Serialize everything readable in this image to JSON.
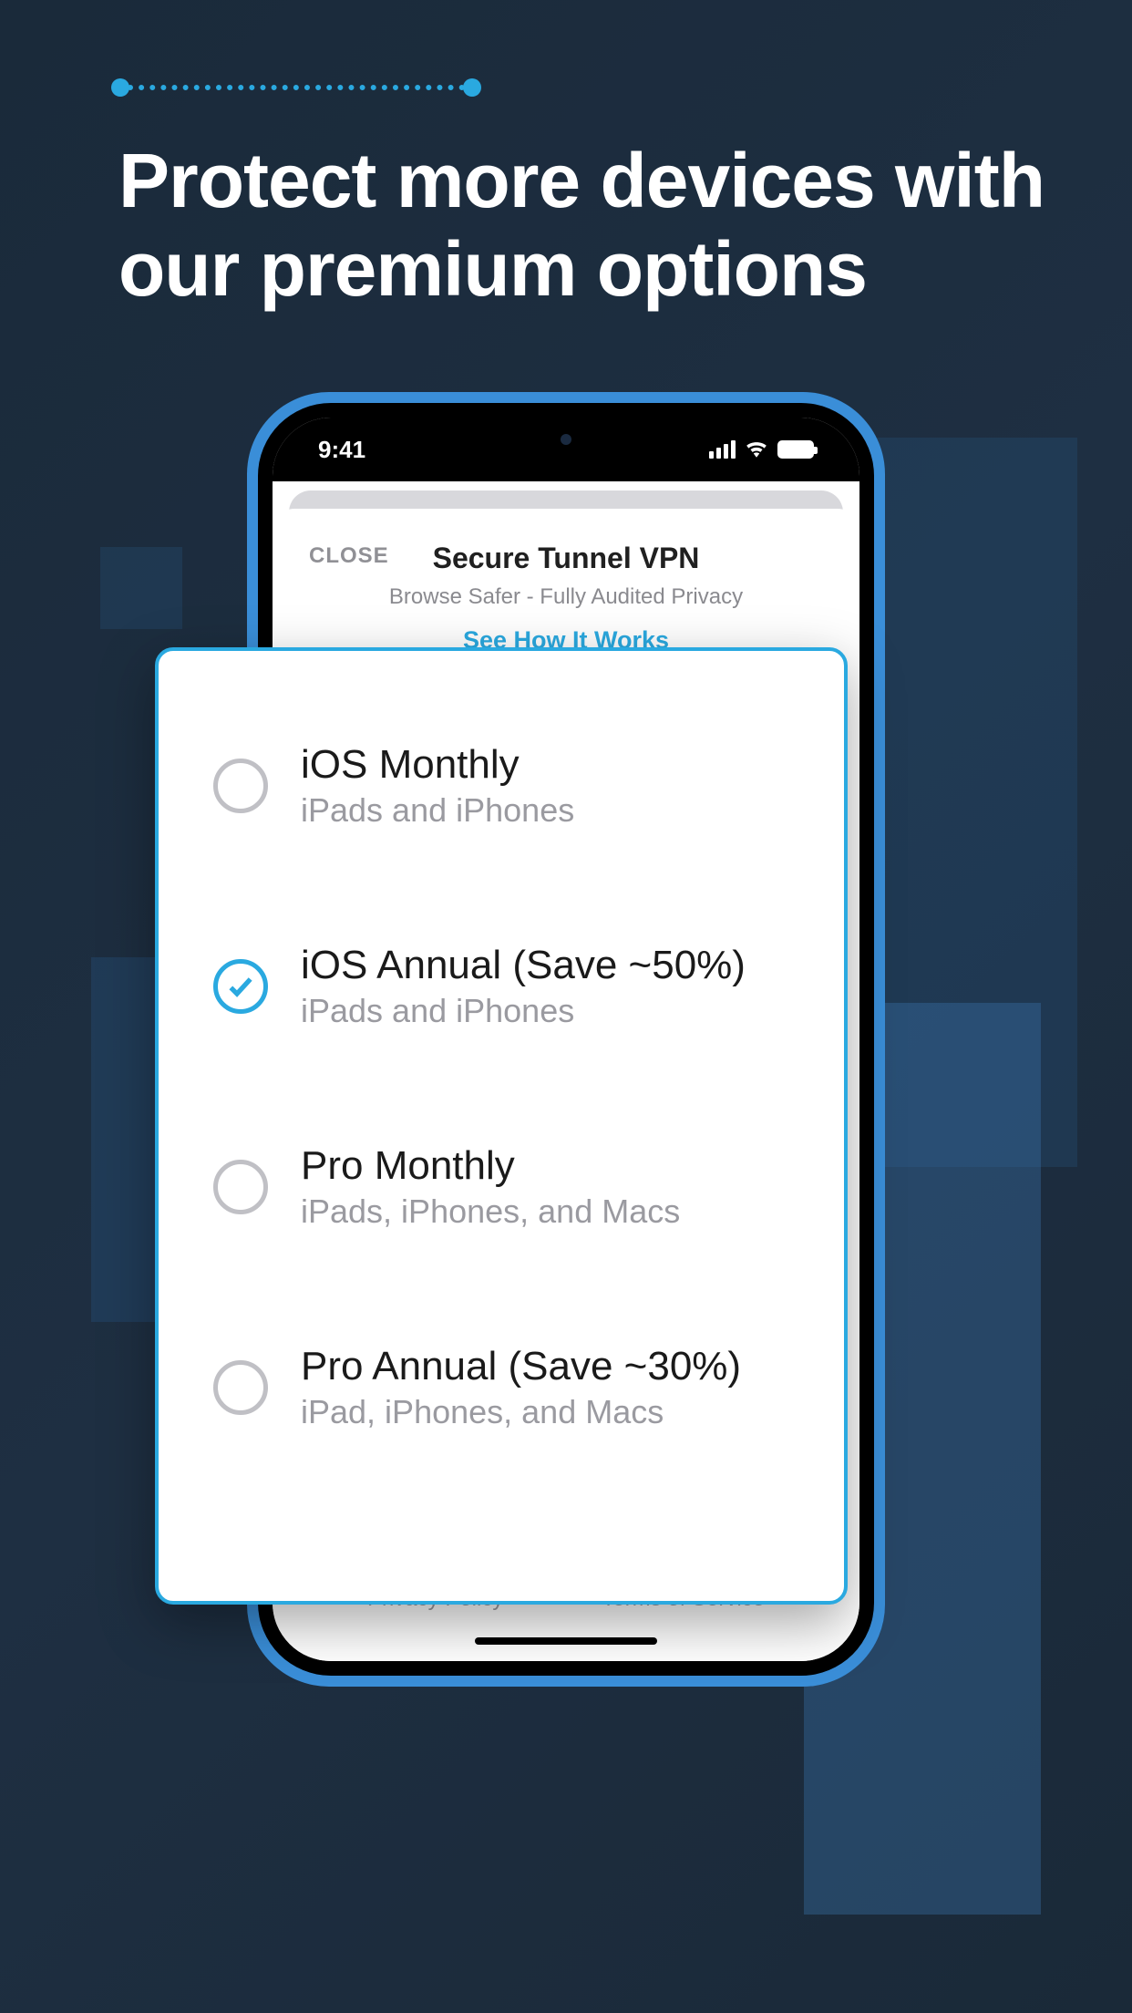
{
  "headline": "Protect more devices with our premium options",
  "status": {
    "time": "9:41"
  },
  "sheet": {
    "close": "CLOSE",
    "title": "Secure Tunnel VPN",
    "subtitle": "Browse Safer - Fully Audited Privacy",
    "link": "See How It Works"
  },
  "plans": [
    {
      "title": "iOS Monthly",
      "subtitle": "iPads and iPhones",
      "selected": false
    },
    {
      "title": "iOS Annual (Save ~50%)",
      "subtitle": "iPads and iPhones",
      "selected": true
    },
    {
      "title": "Pro Monthly",
      "subtitle": "iPads, iPhones, and Macs",
      "selected": false
    },
    {
      "title": "Pro Annual (Save ~30%)",
      "subtitle": "iPad, iPhones, and Macs",
      "selected": false
    }
  ],
  "footer": {
    "privacy": "Privacy Policy",
    "terms": "Terms of Service"
  },
  "colors": {
    "accent": "#2aa9e0"
  }
}
